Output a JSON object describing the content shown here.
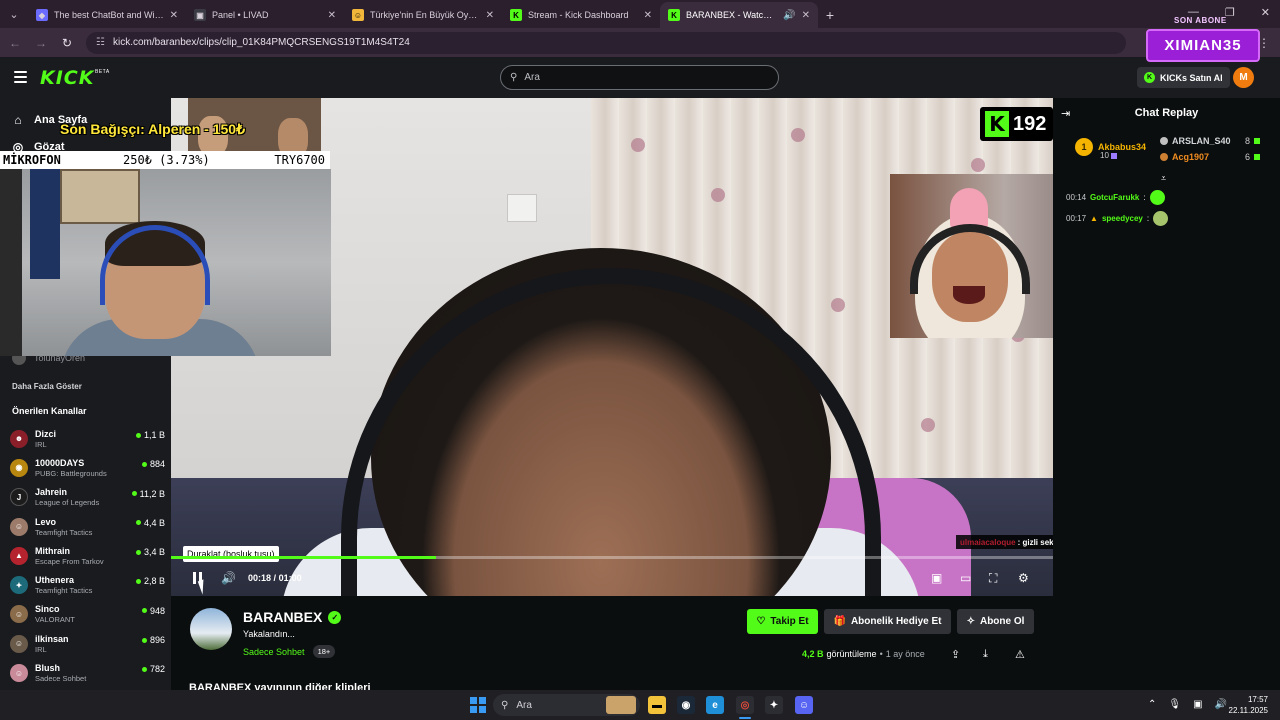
{
  "browser": {
    "tabs": [
      {
        "title": "The best ChatBot and Widgets",
        "fav_color": "#6b6bff",
        "fav_glyph": "◆"
      },
      {
        "title": "Panel • LIVAD",
        "fav_color": "#3b3b45",
        "fav_glyph": "▣"
      },
      {
        "title": "Türkiye'nin En Büyük Oyuncu D",
        "fav_color": "#f2b63a",
        "fav_glyph": "☺"
      },
      {
        "title": "Stream - Kick Dashboard",
        "fav_color": "#53fc18",
        "fav_glyph": "K"
      },
      {
        "title": "BARANBEX - Watch clips on",
        "fav_color": "#53fc18",
        "fav_glyph": "K"
      }
    ],
    "url": "kick.com/baranbex/clips/clip_01K84PMQCRSENGS19T1M4S4T24"
  },
  "header": {
    "logo": "KICK",
    "beta": "BETA",
    "search_placeholder": "Ara",
    "kicks_button": "KICKs Satın Al",
    "user_initial": "M"
  },
  "overlay": {
    "son_abone_label": "SON ABONE",
    "son_abone_name": "XIMIAN35",
    "donation": "Son Bağışçı: Alperen - 150₺",
    "mikrofon_label": "MİKROFON",
    "mikrofon_value": "250₺ (3.73%)",
    "mikrofon_goal": "TRY6700",
    "kick_count": "192",
    "chat_overlay_user": "ulmaiacaloque",
    "chat_overlay_msg": ": gizli sekmede vs aç reis"
  },
  "sidebar": {
    "nav": [
      {
        "label": "Ana Sayfa",
        "icon": "⌂"
      },
      {
        "label": "Gözat",
        "icon": "◎"
      }
    ],
    "partial_user": "TolunayOren",
    "show_more": "Daha Fazla Göster",
    "recommended_title": "Önerilen Kanallar",
    "recommended": [
      {
        "name": "Dizci",
        "category": "IRL",
        "viewers": "1,1 B",
        "color": "#8a1f2a",
        "glyph": "☻"
      },
      {
        "name": "10000DAYS",
        "category": "PUBG: Battlegrounds",
        "viewers": "884",
        "color": "#b8870f",
        "glyph": "◉"
      },
      {
        "name": "Jahrein",
        "category": "League of Legends",
        "viewers": "11,2 B",
        "color": "#1c1c1c",
        "glyph": "J"
      },
      {
        "name": "Levo",
        "category": "Teamfight Tactics",
        "viewers": "4,4 B",
        "color": "#9c7b6a",
        "glyph": "☺"
      },
      {
        "name": "Mithrain",
        "category": "Escape From Tarkov",
        "viewers": "3,4 B",
        "color": "#b5232e",
        "glyph": "▲"
      },
      {
        "name": "Uthenera",
        "category": "Teamfight Tactics",
        "viewers": "2,8 B",
        "color": "#1c6a7a",
        "glyph": "✦"
      },
      {
        "name": "Sinco",
        "category": "VALORANT",
        "viewers": "948",
        "color": "#8a6b4a",
        "glyph": "☺"
      },
      {
        "name": "ilkinsan",
        "category": "IRL",
        "viewers": "896",
        "color": "#6a5a4a",
        "glyph": "☺"
      },
      {
        "name": "Blush",
        "category": "Sadece Sohbet",
        "viewers": "782",
        "color": "#c98a9a",
        "glyph": "☺"
      }
    ]
  },
  "player": {
    "tooltip": "Duraklat (boşluk tuşu)",
    "progress": 0.3,
    "time_current": "00:18",
    "time_sep": "/",
    "time_total": "01:00"
  },
  "channel": {
    "name": "BARANBEX",
    "clip_title": "Yakalandın...",
    "category": "Sadece Sohbet",
    "age": "18+",
    "follow": "Takip Et",
    "gift": "Abonelik Hediye Et",
    "subscribe": "Abone Ol",
    "views_count": "4,2 B",
    "views_label": "görüntüleme",
    "ago": "1 ay önce",
    "more_clips": "BARANBEX yayınının diğer klipleri"
  },
  "chat": {
    "title": "Chat Replay",
    "leaderboard": [
      {
        "rank": "1",
        "name": "Akbabus34",
        "value": "10"
      },
      {
        "name": "ARSLAN_S40",
        "value": "8"
      },
      {
        "name": "Acg1907",
        "value": "6"
      }
    ],
    "messages": [
      {
        "time": "00:14",
        "user": "GotcuFarukk",
        "sep": ":"
      },
      {
        "time": "00:17",
        "user": "speedycey",
        "sep": ":"
      }
    ]
  },
  "taskbar": {
    "search_placeholder": "Ara",
    "time": "17:57",
    "date": "22.11.2025"
  }
}
